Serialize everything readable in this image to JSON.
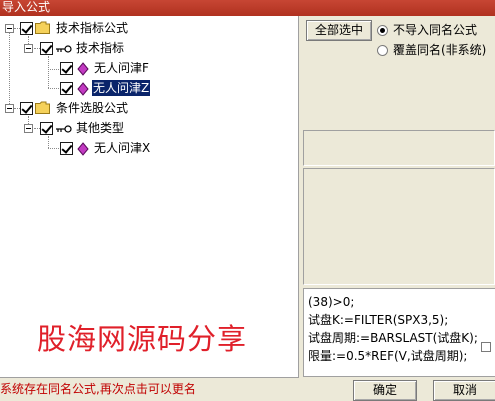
{
  "window": {
    "title": "导入公式"
  },
  "tree": {
    "nodes": [
      {
        "label": "技术指标公式"
      },
      {
        "label": "技术指标"
      },
      {
        "label": "无人问津F"
      },
      {
        "label": "无人问津Z"
      },
      {
        "label": "条件选股公式"
      },
      {
        "label": "其他类型"
      },
      {
        "label": "无人问津X"
      }
    ],
    "selected_index": 3,
    "watermark": "股海网源码分享"
  },
  "options": {
    "select_all_label": "全部选中",
    "radios": [
      {
        "label": "不导入同名公式",
        "checked": true
      },
      {
        "label": "覆盖同名(非系统)",
        "checked": false
      }
    ]
  },
  "formula_text": {
    "lines": [
      "(38)>0;",
      "试盘K:=FILTER(SPX3,5);",
      "试盘周期:=BARSLAST(试盘K);",
      "限量:=0.5*REF(V,试盘周期);"
    ]
  },
  "status": {
    "message": "系统存在同名公式,再次点击可以更名"
  },
  "buttons": {
    "ok_label": "确定",
    "cancel_label": "取消"
  },
  "colors": {
    "title_bar": "#b83a28",
    "selection": "#0a246a",
    "watermark": "#e0202a",
    "status_text": "#c00000"
  },
  "icons": [
    "folder-icon",
    "formula-key-icon",
    "diamond-icon"
  ]
}
